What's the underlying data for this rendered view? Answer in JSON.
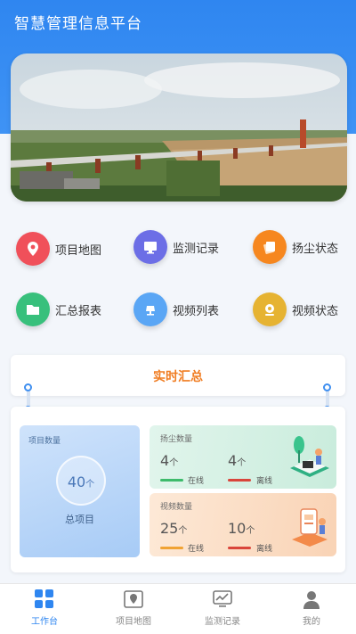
{
  "header": {
    "title": "智慧管理信息平台"
  },
  "menu": {
    "items": [
      {
        "label": "项目地图",
        "icon": "map-pin-icon",
        "color": "#f0505a"
      },
      {
        "label": "监测记录",
        "icon": "monitor-icon",
        "color": "#6c6ee6"
      },
      {
        "label": "扬尘状态",
        "icon": "dust-card-icon",
        "color": "#f6871f"
      },
      {
        "label": "汇总报表",
        "icon": "folder-icon",
        "color": "#38c07c"
      },
      {
        "label": "视频列表",
        "icon": "camera-icon",
        "color": "#5aa6f5"
      },
      {
        "label": "视频状态",
        "icon": "video-camera-icon",
        "color": "#e6b332"
      }
    ]
  },
  "summary": {
    "title": "实时汇总",
    "project": {
      "title": "项目数量",
      "value": "40",
      "unit": "个",
      "caption": "总项目"
    },
    "dust": {
      "title": "扬尘数量",
      "online_value": "4",
      "online_unit": "个",
      "online_label": "在线",
      "offline_value": "4",
      "offline_unit": "个",
      "offline_label": "离线"
    },
    "video": {
      "title": "视频数量",
      "online_value": "25",
      "online_unit": "个",
      "online_label": "在线",
      "offline_value": "10",
      "offline_unit": "个",
      "offline_label": "离线"
    },
    "colors": {
      "online": "#3dbb6b",
      "offline": "#d9453b"
    }
  },
  "tabbar": {
    "items": [
      {
        "label": "工作台",
        "icon": "dashboard-icon",
        "active": true
      },
      {
        "label": "项目地图",
        "icon": "map-icon",
        "active": false
      },
      {
        "label": "监测记录",
        "icon": "chart-monitor-icon",
        "active": false
      },
      {
        "label": "我的",
        "icon": "user-icon",
        "active": false
      }
    ]
  }
}
